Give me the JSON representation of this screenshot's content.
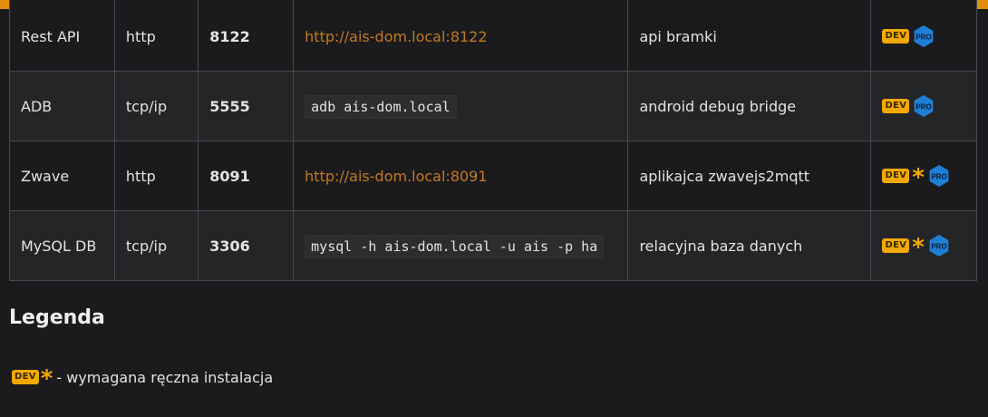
{
  "colors": {
    "accent": "#e38d0f",
    "dev_badge": "#f2a900",
    "pro_badge": "#1f7fd6",
    "link": "#c47a1e"
  },
  "badges": {
    "dev_label": "DEV",
    "star": "*",
    "pro_label": "PRO"
  },
  "rows": [
    {
      "name": "Rest API",
      "protocol": "http",
      "port": "8122",
      "type": "link",
      "value": "http://ais-dom.local:8122",
      "description": "api bramki",
      "star": false
    },
    {
      "name": "ADB",
      "protocol": "tcp/ip",
      "port": "5555",
      "type": "code",
      "value": "adb ais-dom.local",
      "description": "android debug bridge",
      "star": false
    },
    {
      "name": "Zwave",
      "protocol": "http",
      "port": "8091",
      "type": "link",
      "value": "http://ais-dom.local:8091",
      "description": "aplikajca zwavejs2mqtt",
      "star": true
    },
    {
      "name": "MySQL DB",
      "protocol": "tcp/ip",
      "port": "3306",
      "type": "code",
      "value": "mysql -h ais-dom.local -u ais -p ha",
      "description": "relacyjna baza danych",
      "star": true
    }
  ],
  "legend": {
    "title": "Legenda",
    "dev_label": "DEV",
    "star": "*",
    "text": "- wymagana ręczna instalacja"
  }
}
